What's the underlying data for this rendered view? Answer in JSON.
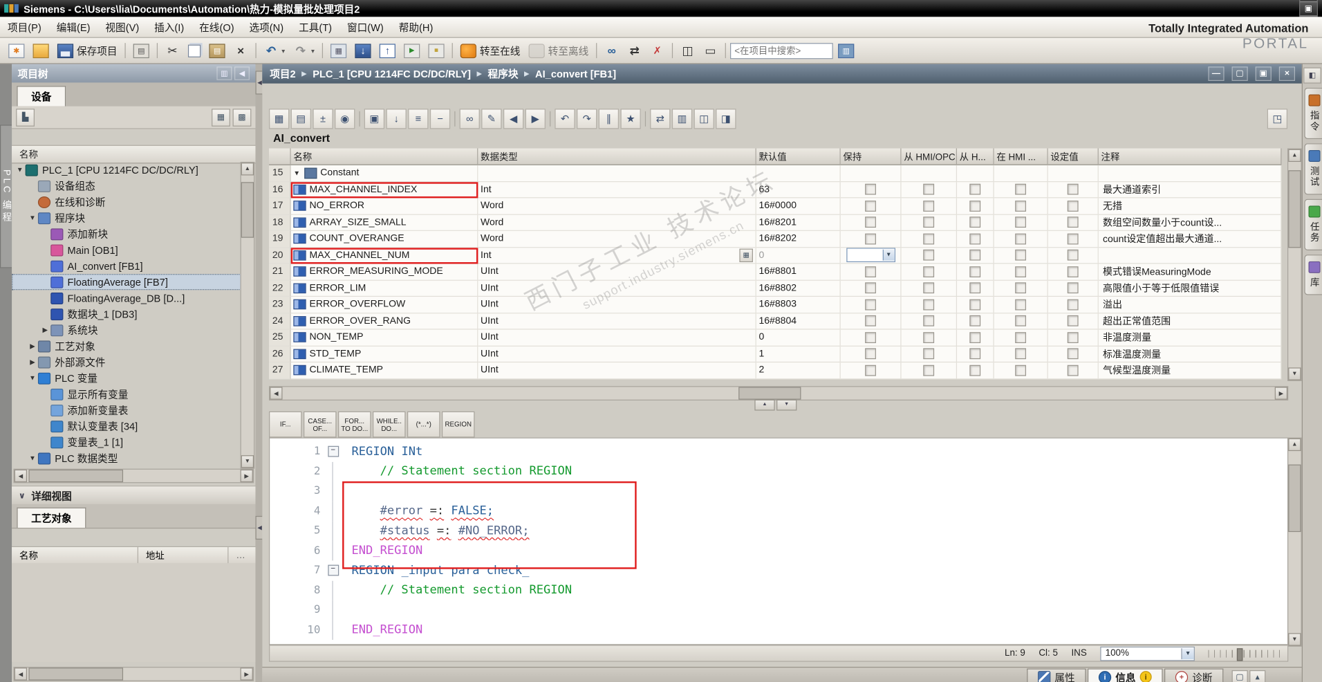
{
  "window": {
    "title": "Siemens - C:\\Users\\lia\\Documents\\Automation\\热力-模拟量批处理项目2",
    "buttons": [
      {
        "name": "minimize-app-icon",
        "glyph": "—"
      },
      {
        "name": "restore-app-icon",
        "glyph": "▣"
      },
      {
        "name": "close-app-icon",
        "glyph": "×"
      }
    ]
  },
  "branding": {
    "line1": "Totally Integrated Automation",
    "line2": "PORTAL"
  },
  "menu": {
    "items": [
      "项目(P)",
      "编辑(E)",
      "视图(V)",
      "插入(I)",
      "在线(O)",
      "选项(N)",
      "工具(T)",
      "窗口(W)",
      "帮助(H)"
    ]
  },
  "toolbar": {
    "search_placeholder": "<在项目中搜索>",
    "items": [
      {
        "name": "new-project-icon",
        "icon": "page",
        "glyph": "✱"
      },
      {
        "name": "open-project-icon",
        "icon": "folder",
        "glyph": ""
      },
      {
        "name": "save-project-button",
        "icon": "floppy",
        "glyph": "",
        "label": "保存项目"
      },
      {
        "sep": true
      },
      {
        "name": "print-icon",
        "icon": "print",
        "glyph": "▤"
      },
      {
        "sep": true
      },
      {
        "name": "cut-icon",
        "icon": "dark",
        "glyph": "✂"
      },
      {
        "name": "copy-icon",
        "icon": "copy",
        "glyph": ""
      },
      {
        "name": "paste-icon",
        "icon": "paste",
        "glyph": "▤"
      },
      {
        "name": "delete-icon",
        "icon": "dark",
        "glyph": "×"
      },
      {
        "sep": true
      },
      {
        "name": "undo-icon",
        "icon": "blue",
        "glyph": "↶",
        "caret": true
      },
      {
        "name": "redo-icon",
        "icon": "gray",
        "glyph": "↷",
        "caret": true
      },
      {
        "sep": true
      },
      {
        "name": "compile-icon",
        "icon": "chip",
        "glyph": "▦"
      },
      {
        "name": "download-to-device-icon",
        "icon": "download",
        "glyph": "↓"
      },
      {
        "name": "upload-from-device-icon",
        "icon": "upload",
        "glyph": "↑"
      },
      {
        "name": "start-cpu-icon",
        "icon": "runstop",
        "glyph": "▶"
      },
      {
        "name": "stop-cpu-icon",
        "icon": "runstop2",
        "glyph": "■"
      },
      {
        "sep": true
      },
      {
        "name": "go-online-button",
        "icon": "online",
        "glyph": "",
        "label": "转至在线"
      },
      {
        "name": "go-offline-button",
        "icon": "offline",
        "glyph": "",
        "label": "转至离线",
        "disabled": true
      },
      {
        "sep": true
      },
      {
        "name": "monitor-icon",
        "icon": "blue",
        "glyph": "∞"
      },
      {
        "name": "cross-reference-icon",
        "icon": "dark",
        "glyph": "⇄"
      },
      {
        "name": "remove-icon",
        "icon": "red",
        "glyph": "✗"
      },
      {
        "sep": true
      },
      {
        "name": "split-editor-horizontal-icon",
        "icon": "dark",
        "glyph": "◫"
      },
      {
        "name": "split-editor-vertical-icon",
        "icon": "dark",
        "glyph": "▭"
      },
      {
        "sep": true
      },
      {
        "name": "search-input",
        "input": true
      },
      {
        "name": "library-view-icon",
        "icon": "lib",
        "glyph": "▥"
      }
    ]
  },
  "left_rail": {
    "label": "PLC 编程"
  },
  "project_tree": {
    "title": "项目树",
    "header_icons": [
      {
        "name": "pin-panel-icon",
        "glyph": "▥"
      },
      {
        "name": "collapse-panel-icon",
        "glyph": "◀"
      }
    ],
    "device_tab": "设备",
    "name_column": "名称",
    "items": [
      {
        "label": "PLC_1 [CPU 1214FC DC/DC/RLY]",
        "level": 1,
        "icon": "plc",
        "expand": "open"
      },
      {
        "label": "设备组态",
        "level": 2,
        "icon": "devcfg"
      },
      {
        "label": "在线和诊断",
        "level": 2,
        "icon": "diag"
      },
      {
        "label": "程序块",
        "level": 2,
        "icon": "folder",
        "expand": "open"
      },
      {
        "label": "添加新块",
        "level": 3,
        "icon": "addblock"
      },
      {
        "label": "Main [OB1]",
        "level": 3,
        "icon": "ob"
      },
      {
        "label": "AI_convert [FB1]",
        "level": 3,
        "icon": "fb"
      },
      {
        "label": "FloatingAverage [FB7]",
        "level": 3,
        "icon": "fb",
        "selected": true
      },
      {
        "label": "FloatingAverage_DB [D...]",
        "level": 3,
        "icon": "db"
      },
      {
        "label": "数据块_1 [DB3]",
        "level": 3,
        "icon": "db"
      },
      {
        "label": "系统块",
        "level": 3,
        "icon": "sysfolder",
        "expand": "closed"
      },
      {
        "label": "工艺对象",
        "level": 2,
        "icon": "techfolder",
        "expand": "closed"
      },
      {
        "label": "外部源文件",
        "level": 2,
        "icon": "extfolder",
        "expand": "closed"
      },
      {
        "label": "PLC 变量",
        "level": 2,
        "icon": "tags",
        "expand": "open"
      },
      {
        "label": "显示所有变量",
        "level": 3,
        "icon": "showtags"
      },
      {
        "label": "添加新变量表",
        "level": 3,
        "icon": "addtable"
      },
      {
        "label": "默认变量表 [34]",
        "level": 3,
        "icon": "tagtable"
      },
      {
        "label": "变量表_1 [1]",
        "level": 3,
        "icon": "tagtable"
      },
      {
        "label": "PLC 数据类型",
        "level": 2,
        "icon": "datatypes",
        "expand": "open"
      }
    ]
  },
  "details_view": {
    "title": "详细视图",
    "tab": "工艺对象",
    "columns": [
      "名称",
      "地址"
    ]
  },
  "breadcrumb": {
    "segments": [
      "项目2",
      "PLC_1 [CPU 1214FC DC/DC/RLY]",
      "程序块",
      "AI_convert [FB1]"
    ],
    "buttons": [
      {
        "name": "minimize-editor-icon",
        "glyph": "—"
      },
      {
        "name": "restore-editor-icon",
        "glyph": "▢"
      },
      {
        "name": "maximize-editor-icon",
        "glyph": "▣"
      },
      {
        "name": "close-editor-icon",
        "glyph": "×"
      }
    ]
  },
  "editor_toolbar": {
    "items": [
      {
        "n": "insert-row-icon",
        "g": "▦"
      },
      {
        "n": "add-row-icon",
        "g": "▤"
      },
      {
        "n": "keep-actual-values-icon",
        "g": "±"
      },
      {
        "n": "snapshot-icon",
        "g": "◉"
      },
      {
        "sep": true
      },
      {
        "n": "copy-snapshots-icon",
        "g": "▣"
      },
      {
        "n": "load-start-values-icon",
        "g": "↓"
      },
      {
        "n": "expand-all-icon",
        "g": "≡"
      },
      {
        "n": "collapse-all-icon",
        "g": "−"
      },
      {
        "sep": true
      },
      {
        "n": "monitor-all-icon",
        "g": "∞"
      },
      {
        "n": "modify-value-icon",
        "g": "✎"
      },
      {
        "n": "prev-error-icon",
        "g": "◀"
      },
      {
        "n": "next-error-icon",
        "g": "▶"
      },
      {
        "sep": true
      },
      {
        "n": "goto-prev-icon",
        "g": "↶"
      },
      {
        "n": "goto-next-icon",
        "g": "↷"
      },
      {
        "n": "comment-icon",
        "g": "∥"
      },
      {
        "n": "favorites-icon",
        "g": "★"
      },
      {
        "sep": true
      },
      {
        "n": "update-block-calls-icon",
        "g": "⇄"
      },
      {
        "n": "absolute-operands-icon",
        "g": "▥"
      },
      {
        "n": "hide-display-icon",
        "g": "◫"
      },
      {
        "n": "editor-settings-icon",
        "g": "◨"
      }
    ],
    "right_icon": {
      "n": "maximize-editor-area-icon",
      "g": "◳"
    }
  },
  "block": {
    "title": "AI_convert"
  },
  "iface_table": {
    "columns": [
      "名称",
      "数据类型",
      "默认值",
      "保持",
      "从 HMI/OPC..",
      "从 H...",
      "在 HMI ...",
      "设定值",
      "注释"
    ],
    "rows": [
      {
        "num": "15",
        "group": true,
        "name": "Constant"
      },
      {
        "num": "16",
        "name": "MAX_CHANNEL_INDEX",
        "type": "Int",
        "def": "63",
        "comment": "最大通道索引",
        "red": true
      },
      {
        "num": "17",
        "name": "NO_ERROR",
        "type": "Word",
        "def": "16#0000",
        "comment": "无措"
      },
      {
        "num": "18",
        "name": "ARRAY_SIZE_SMALL",
        "type": "Word",
        "def": "16#8201",
        "comment": "数组空间数量小于count设..."
      },
      {
        "num": "19",
        "name": "COUNT_OVERANGE",
        "type": "Word",
        "def": "16#8202",
        "comment": "count设定值超出最大通道..."
      },
      {
        "num": "20",
        "name": "MAX_CHANNEL_NUM",
        "type": "Int",
        "def": "0",
        "comment": "",
        "red": true,
        "focus": true
      },
      {
        "num": "21",
        "name": "ERROR_MEASURING_MODE",
        "type": "UInt",
        "def": "16#8801",
        "comment": "模式错误MeasuringMode"
      },
      {
        "num": "22",
        "name": "ERROR_LIM",
        "type": "UInt",
        "def": "16#8802",
        "comment": "高限值小于等于低限值错误"
      },
      {
        "num": "23",
        "name": "ERROR_OVERFLOW",
        "type": "UInt",
        "def": "16#8803",
        "comment": "溢出"
      },
      {
        "num": "24",
        "name": "ERROR_OVER_RANG",
        "type": "UInt",
        "def": "16#8804",
        "comment": "超出正常值范围"
      },
      {
        "num": "25",
        "name": "NON_TEMP",
        "type": "UInt",
        "def": "0",
        "comment": "非温度测量"
      },
      {
        "num": "26",
        "name": "STD_TEMP",
        "type": "UInt",
        "def": "1",
        "comment": "标准温度测量"
      },
      {
        "num": "27",
        "name": "CLIMATE_TEMP",
        "type": "UInt",
        "def": "2",
        "comment": "气候型温度测量"
      }
    ]
  },
  "snippets": {
    "tabs": [
      {
        "l1": "IF...",
        "l2": ""
      },
      {
        "l1": "CASE...",
        "l2": "OF..."
      },
      {
        "l1": "FOR...",
        "l2": "TO DO..."
      },
      {
        "l1": "WHILE..",
        "l2": "DO..."
      },
      {
        "l1": "(*...*)",
        "l2": ""
      },
      {
        "l1": "REGION",
        "l2": ""
      }
    ]
  },
  "code": {
    "lines": [
      {
        "n": "1",
        "fold": true,
        "t": [
          [
            "REGION",
            "kw"
          ],
          [
            " INt",
            "kw"
          ]
        ]
      },
      {
        "n": "2",
        "guide": true,
        "t": [
          [
            "    // Statement section REGION",
            "cmt"
          ]
        ]
      },
      {
        "n": "3",
        "guide": true,
        "t": []
      },
      {
        "n": "4",
        "guide": true,
        "t": [
          [
            "    ",
            ""
          ],
          [
            "#error",
            "var err"
          ],
          [
            " ",
            ""
          ],
          [
            "=:",
            "op err"
          ],
          [
            " ",
            ""
          ],
          [
            "FALSE;",
            "kw err"
          ]
        ]
      },
      {
        "n": "5",
        "guide": true,
        "t": [
          [
            "    ",
            ""
          ],
          [
            "#status",
            "var err"
          ],
          [
            " ",
            ""
          ],
          [
            "=:",
            "op err"
          ],
          [
            " ",
            ""
          ],
          [
            "#NO_ERROR;",
            "var err"
          ]
        ]
      },
      {
        "n": "6",
        "guide": true,
        "t": [
          [
            "END_REGION",
            "endkw"
          ]
        ]
      },
      {
        "n": "7",
        "fold": true,
        "t": [
          [
            "REGION",
            "kw"
          ],
          [
            " _input para check_",
            "kw"
          ]
        ]
      },
      {
        "n": "8",
        "guide": true,
        "t": [
          [
            "    // Statement section REGION",
            "cmt"
          ]
        ]
      },
      {
        "n": "9",
        "guide": true,
        "t": []
      },
      {
        "n": "10",
        "guide": true,
        "t": [
          [
            "END_REGION",
            "endkw"
          ]
        ]
      }
    ],
    "status": {
      "ln": "Ln: 9",
      "col": "Cl: 5",
      "mode": "INS",
      "zoom": "100%"
    }
  },
  "bottom_tabs": {
    "properties": "属性",
    "info": "信息",
    "diagnostics": "诊断"
  },
  "right_rail": {
    "collapse_icon": "◧",
    "tabs": [
      {
        "label": "指令",
        "color": "#c8702a"
      },
      {
        "label": "测试",
        "color": "#4a7ab8"
      },
      {
        "label": "任务",
        "color": "#4aa84a"
      },
      {
        "label": "库",
        "color": "#8a6fc0"
      }
    ]
  },
  "watermark": {
    "line1": "西门子工业  技术论坛",
    "line2": "support.industry.siemens.cn"
  },
  "colors": {
    "annotation": "#e01f1f",
    "online_orange": "#e07b10",
    "keyword_blue": "#2a6099",
    "comment_green": "#149a2e",
    "region_magenta": "#c44fd0"
  }
}
